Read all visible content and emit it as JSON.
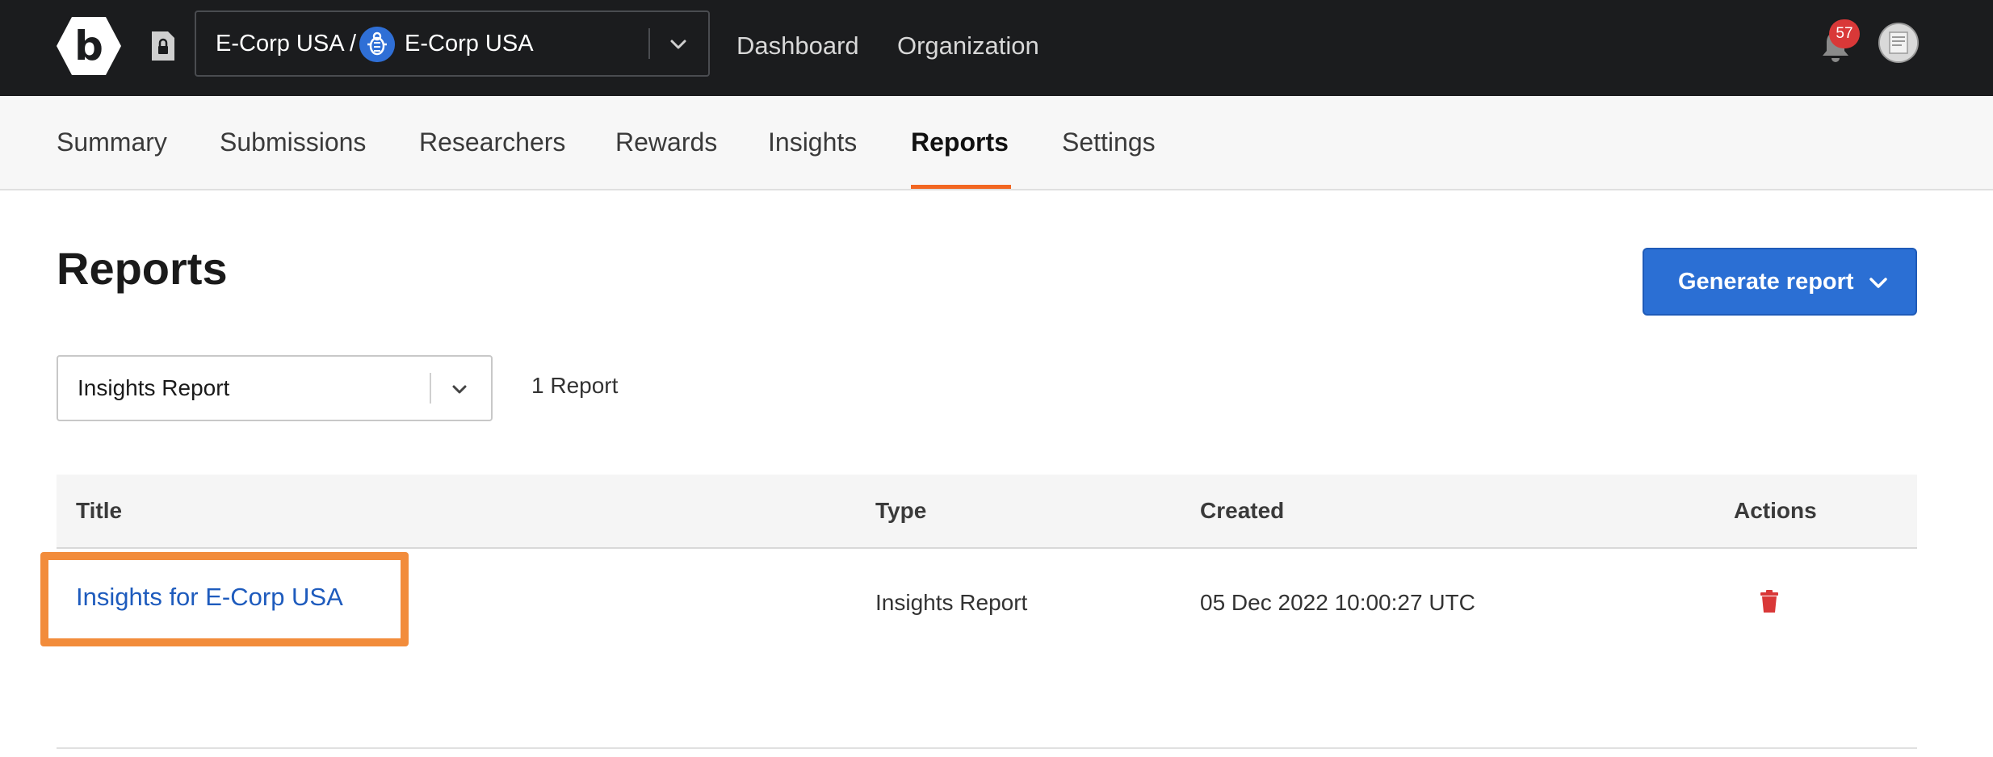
{
  "topbar": {
    "org_path": "E-Corp USA /",
    "org_name": "E-Corp USA",
    "links": [
      "Dashboard",
      "Organization"
    ],
    "notification_count": "57"
  },
  "tabs": [
    {
      "label": "Summary"
    },
    {
      "label": "Submissions"
    },
    {
      "label": "Researchers"
    },
    {
      "label": "Rewards"
    },
    {
      "label": "Insights"
    },
    {
      "label": "Reports",
      "active": true
    },
    {
      "label": "Settings"
    }
  ],
  "main": {
    "title": "Reports",
    "generate_label": "Generate report",
    "filter_value": "Insights Report",
    "count_label": "1 Report"
  },
  "table": {
    "headers": [
      "Title",
      "Type",
      "Created",
      "Actions"
    ],
    "rows": [
      {
        "title": "Insights for E-Corp USA",
        "type": "Insights Report",
        "created": "05 Dec 2022 10:00:27 UTC"
      }
    ]
  },
  "colors": {
    "topbar_bg": "#1b1c1e",
    "accent_orange": "#f26722",
    "primary_blue": "#2b6fd4",
    "link_blue": "#1e5bbd",
    "danger_red": "#d93838"
  }
}
